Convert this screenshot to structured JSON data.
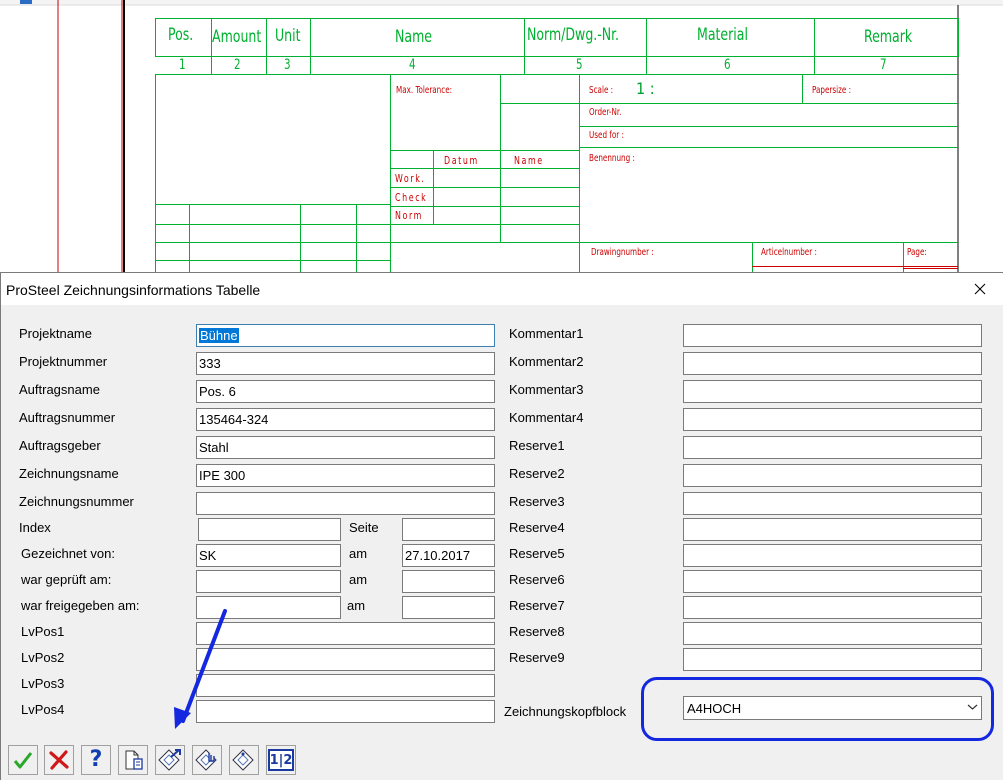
{
  "cad": {
    "headers": [
      "Pos.",
      "Amount",
      "Unit",
      "Name",
      "Norm/Dwg.-Nr.",
      "Material",
      "Remark"
    ],
    "numbers": [
      "1",
      "2",
      "3",
      "4",
      "5",
      "6",
      "7"
    ],
    "max_tolerance": "Max. Tolerance:",
    "scale": "Scale :",
    "scale_value": "1 :",
    "papersize": "Papersize :",
    "order_nr": "Order-Nr.",
    "used_for": "Used for :",
    "datum": "Datum",
    "name": "Name",
    "benennung": "Benennung :",
    "work": "Work.",
    "check": "Check",
    "norm": "Norm",
    "drawingnumber": "Drawingnumber :",
    "articelnumber": "Articelnumber :",
    "page": "Page:"
  },
  "dialog": {
    "title": "ProSteel Zeichnungsinformations Tabelle",
    "labels": {
      "projektname": "Projektname",
      "projektnummer": "Projektnummer",
      "auftragsname": "Auftragsname",
      "auftragsnummer": "Auftragsnummer",
      "auftragsgeber": "Auftragsgeber",
      "zeichnungsname": "Zeichnungsname",
      "zeichnungsnummer": "Zeichnungsnummer",
      "index": "Index",
      "seite": "Seite",
      "gezeichnet": "Gezeichnet von:",
      "am1": "am",
      "geprueft": "war geprüft am:",
      "am2": "am",
      "freigegeben": "war freigegeben am:",
      "am3": "am",
      "lvpos1": "LvPos1",
      "lvpos2": "LvPos2",
      "lvpos3": "LvPos3",
      "lvpos4": "LvPos4",
      "kommentar1": "Kommentar1",
      "kommentar2": "Kommentar2",
      "kommentar3": "Kommentar3",
      "kommentar4": "Kommentar4",
      "reserve1": "Reserve1",
      "reserve2": "Reserve2",
      "reserve3": "Reserve3",
      "reserve4": "Reserve4",
      "reserve5": "Reserve5",
      "reserve6": "Reserve6",
      "reserve7": "Reserve7",
      "reserve8": "Reserve8",
      "reserve9": "Reserve9",
      "zeichnungskopfblock": "Zeichnungskopfblock"
    },
    "values": {
      "projektname": "Bühne",
      "projektnummer": "333",
      "auftragsname": "Pos. 6",
      "auftragsnummer": "135464-324",
      "auftragsgeber": "Stahl",
      "zeichnungsname": "IPE 300",
      "zeichnungsnummer": "",
      "index": "",
      "seite": "",
      "gezeichnet": "SK",
      "gezeichnet_am": "27.10.2017",
      "geprueft": "",
      "geprueft_am": "",
      "freigegeben": "",
      "freigegeben_am": "",
      "lvpos1": "",
      "lvpos2": "",
      "lvpos3": "",
      "lvpos4": "",
      "kommentar1": "",
      "kommentar2": "",
      "kommentar3": "",
      "kommentar4": "",
      "reserve1": "",
      "reserve2": "",
      "reserve3": "",
      "reserve4": "",
      "reserve5": "",
      "reserve6": "",
      "reserve7": "",
      "reserve8": "",
      "reserve9": "",
      "zeichnungskopfblock": "A4HOCH"
    },
    "toolbar": [
      "ok-check-icon",
      "cancel-x-icon",
      "help-question-icon",
      "document-icon",
      "tag-arrow-icon",
      "tag-hand-icon",
      "tag-icon",
      "numbering-icon"
    ],
    "toolbar_numbering_label": "1|2",
    "colors": {
      "accent_blue": "#1428e0",
      "cad_green": "#00b030",
      "cad_red": "#cc0000",
      "selection": "#0078d7"
    }
  }
}
